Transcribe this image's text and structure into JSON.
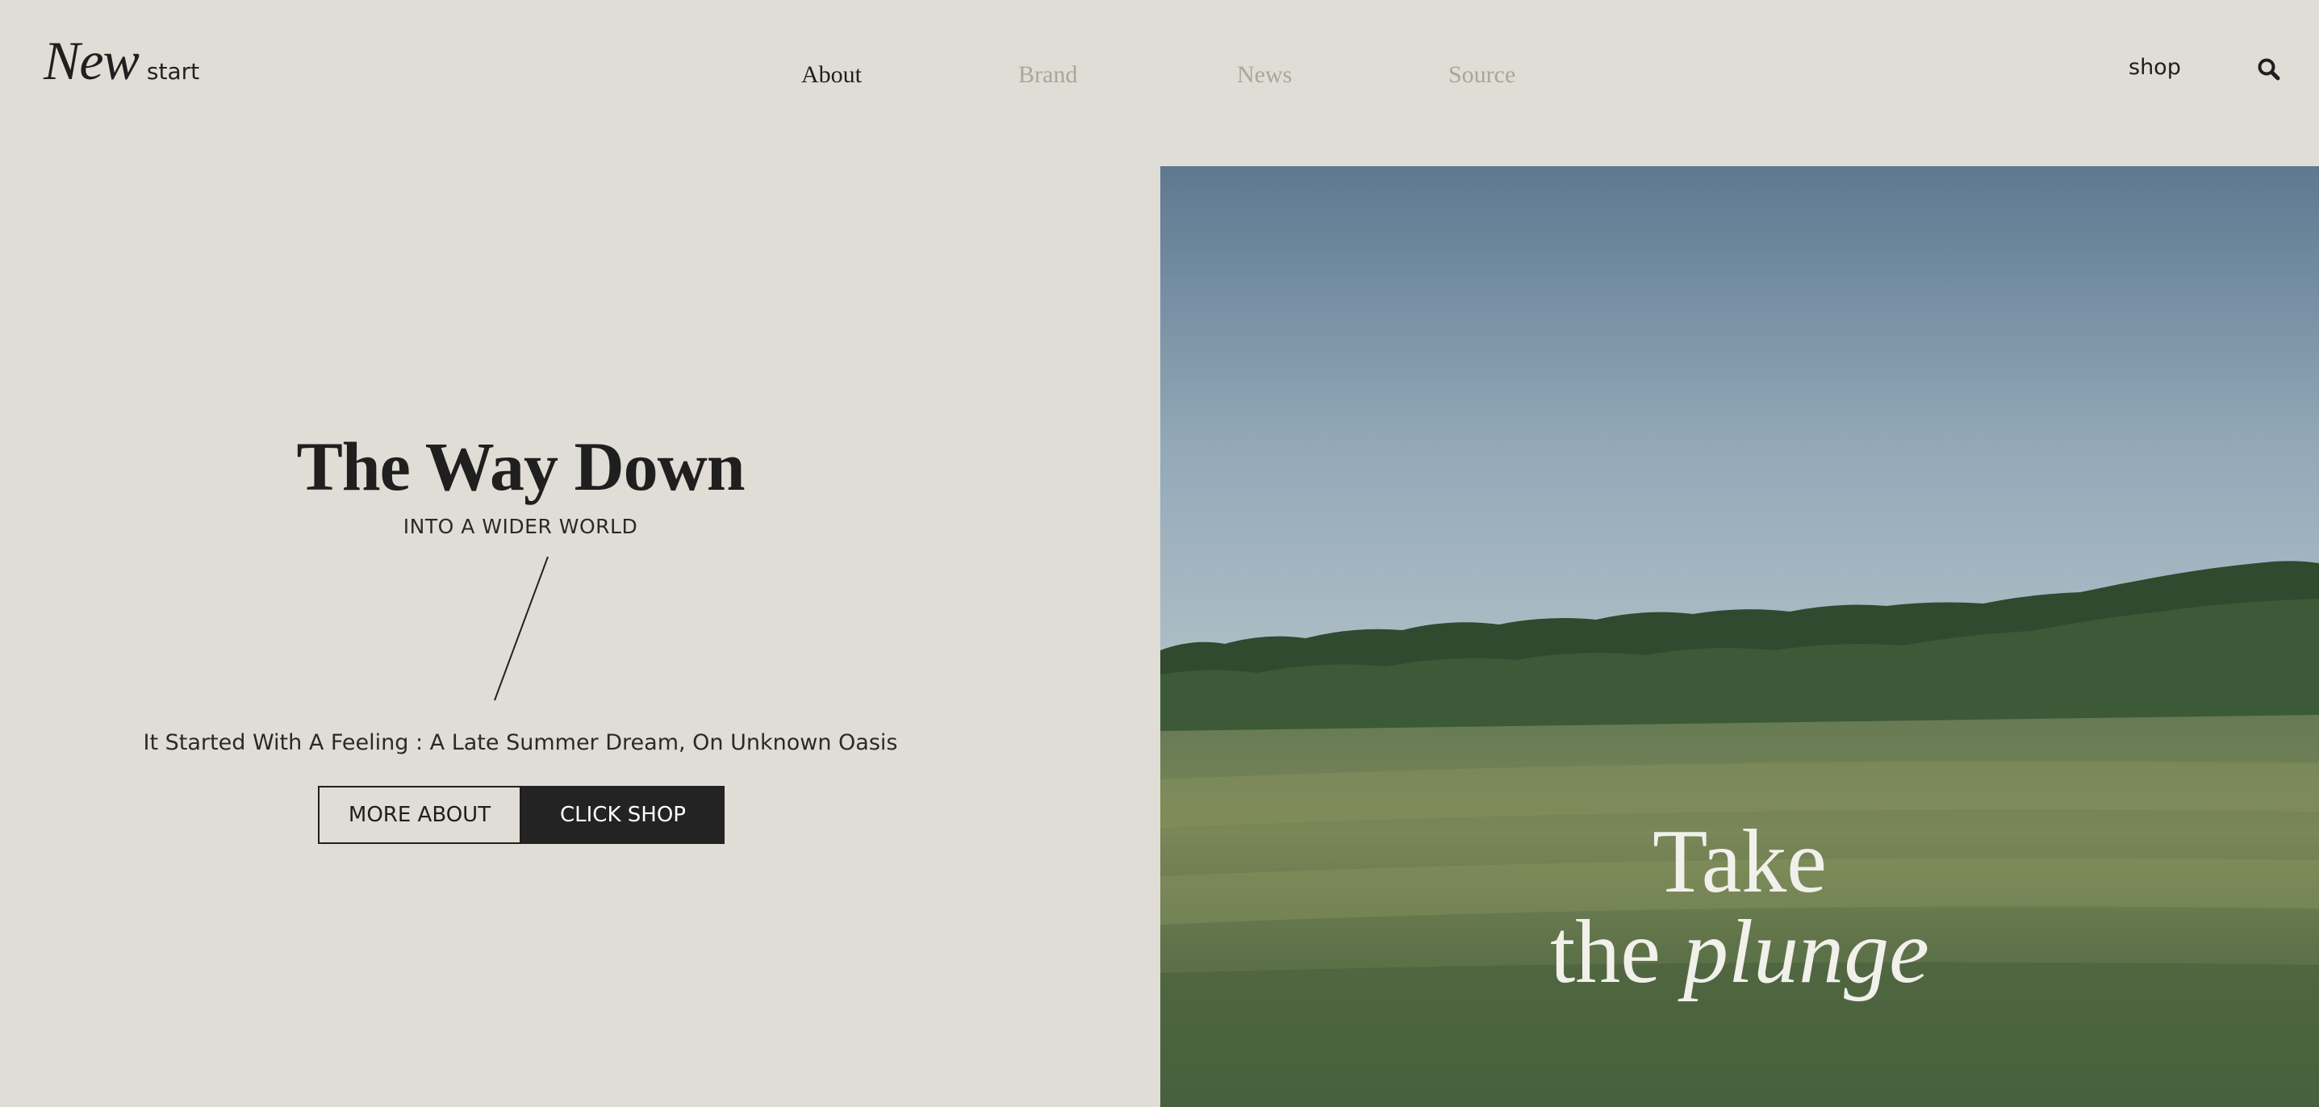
{
  "logo": {
    "word": "New",
    "sub": "start"
  },
  "nav": {
    "items": [
      {
        "label": "About",
        "state": "active"
      },
      {
        "label": "Brand",
        "state": "muted"
      },
      {
        "label": "News",
        "state": "muted"
      },
      {
        "label": "Source",
        "state": "muted"
      }
    ]
  },
  "header": {
    "shop_label": "shop",
    "search_icon": "search-icon"
  },
  "hero": {
    "title": "The Way Down",
    "subtitle": "INTO A WIDER WORLD",
    "description": "It Started With A Feeling : A Late Summer Dream, On Unknown Oasis",
    "more_button": "MORE ABOUT",
    "shop_button": "CLICK SHOP"
  },
  "photo_caption": {
    "line1": "Take",
    "line2_plain": "the",
    "line2_italic": "plunge"
  },
  "colors": {
    "background": "#dfddd5",
    "text": "#1f1f1f",
    "muted": "#a9a69e",
    "button_dark": "#232323",
    "caption": "#f1f0ea"
  }
}
